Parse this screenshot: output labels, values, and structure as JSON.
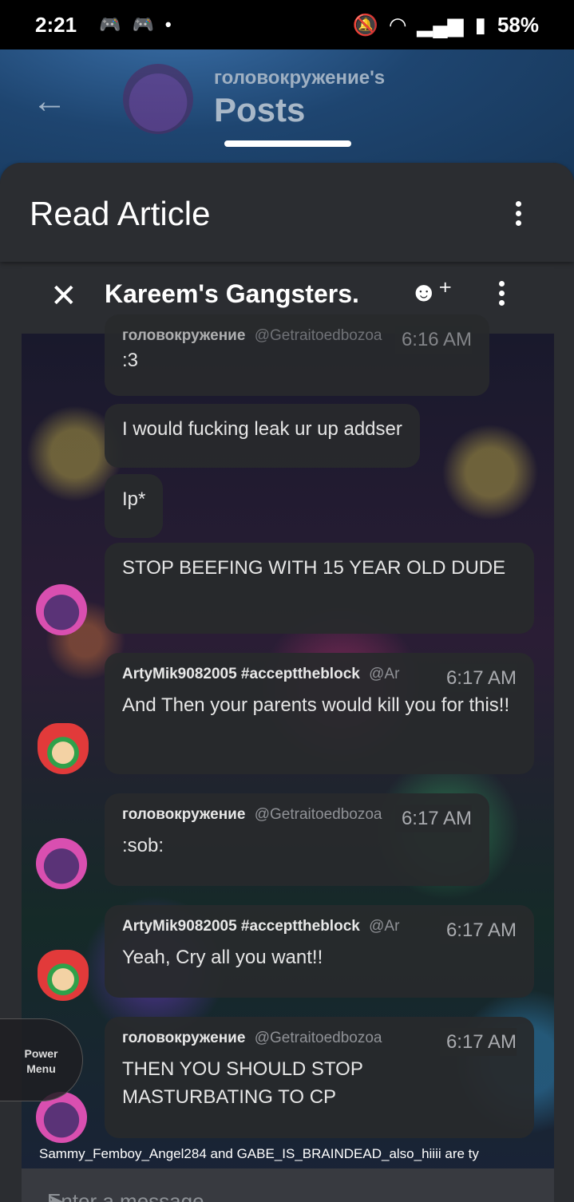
{
  "status_bar": {
    "time": "2:21",
    "battery": "58%",
    "icons": [
      "discord-icon",
      "discord-icon",
      "dot-icon",
      "bell-off-icon",
      "wifi-icon",
      "signal-icon",
      "battery-charging-icon"
    ]
  },
  "posts_header": {
    "subtitle": "головокружение's",
    "title": "Posts"
  },
  "sheet": {
    "title": "Read Article"
  },
  "chat": {
    "title": "Kareem's Gangsters.",
    "messages": [
      {
        "author": "головокружение",
        "handle": "@Getraitoedbozoa",
        "time": "6:16 AM",
        "text": ":3"
      },
      {
        "text": "I would fucking leak ur up addser"
      },
      {
        "text": "Ip*"
      },
      {
        "text": "STOP BEEFING WITH 15 YEAR OLD DUDE"
      },
      {
        "author": "ArtyMik9082005 #accepttheblock",
        "handle": "@Ar",
        "time": "6:17 AM",
        "text": "And Then your parents would kill you for this!!"
      },
      {
        "author": "головокружение",
        "handle": "@Getraitoedbozoa",
        "time": "6:17 AM",
        "text": ":sob:"
      },
      {
        "author": "ArtyMik9082005 #accepttheblock",
        "handle": "@Ar",
        "time": "6:17 AM",
        "text": "Yeah, Cry all you want!!"
      },
      {
        "author": "головокружение",
        "handle": "@Getraitoedbozoa",
        "time": "6:17 AM",
        "text": "THEN YOU SHOULD STOP MASTURBATING TO CP"
      }
    ],
    "typing": "Sammy_Femboy_Angel284 and GABE_IS_BRAINDEAD_also_hiiii are ty",
    "input_placeholder": "Enter a message"
  },
  "power_menu": {
    "line1": "Power",
    "line2": "Menu"
  }
}
